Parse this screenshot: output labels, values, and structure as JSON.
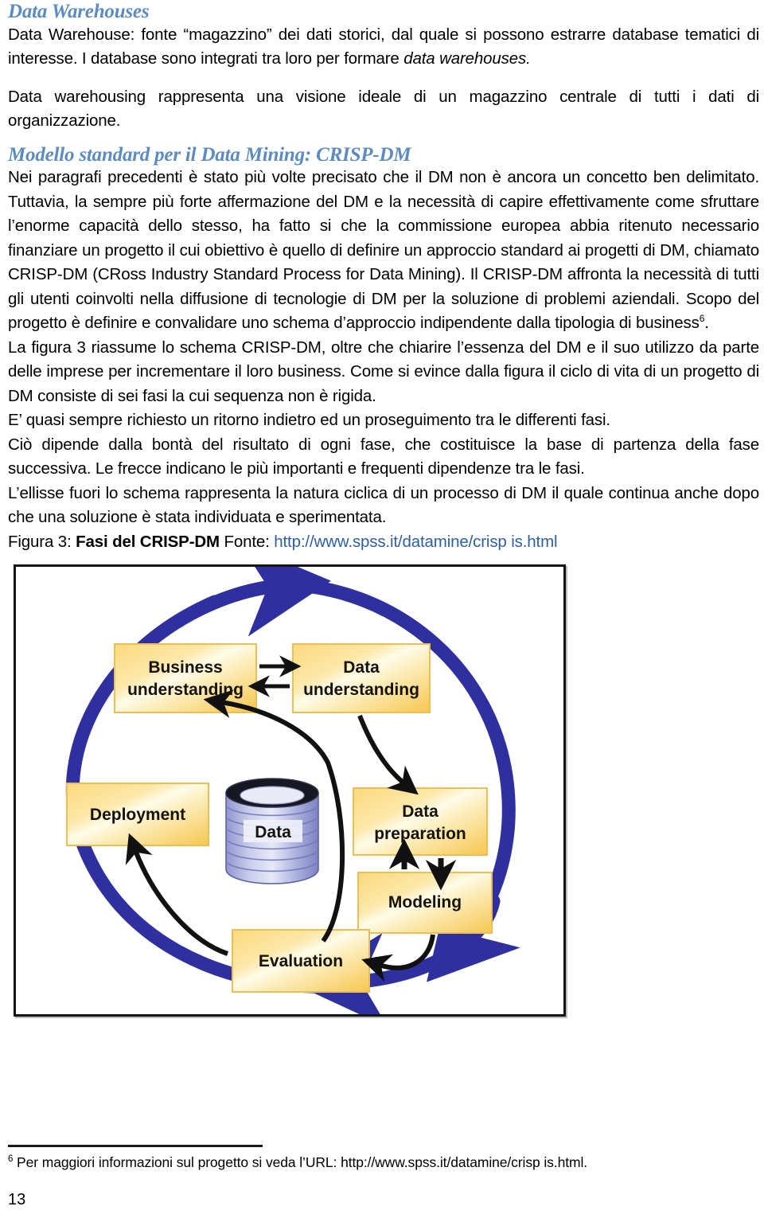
{
  "document": {
    "page_number": "13",
    "heading_color": "#5B8BC0",
    "link_color": "#2E5FA3"
  },
  "section_warehouses": {
    "heading": "Data Warehouses",
    "para1_a": "Data Warehouse: fonte “magazzino” dei dati storici, dal quale si possono estrarre database tematici di interesse. I database sono integrati tra loro per formare ",
    "para1_italic": "data warehouses.",
    "para2": "Data warehousing rappresenta una visione ideale di un magazzino centrale di tutti i dati di organizzazione."
  },
  "section_crisp": {
    "heading": "Modello standard per il Data Mining: CRISP-DM",
    "para1_a": "Nei paragrafi precedenti è stato più volte precisato che il DM non è ancora un concetto ben delimitato. Tuttavia, la sempre più forte affermazione del DM e la necessità di capire effettivamente come sfruttare l’enorme capacità dello stesso, ha fatto si che la commissione europea abbia ritenuto necessario finanziare un progetto il cui obiettivo è quello di definire un approccio standard ai progetti di DM, chiamato CRISP-DM (CRoss Industry Standard Process for Data Mining). Il CRISP-DM affronta la necessità di tutti gli utenti coinvolti nella diffusione di tecnologie di DM per la soluzione di problemi aziendali. Scopo del progetto è definire e convalidare uno schema d’approccio indipendente dalla tipologia di business",
    "para1_footnote_marker": "6",
    "para1_b": ".",
    "para2": "La figura 3 riassume lo schema CRISP-DM, oltre che chiarire l’essenza del DM e il suo utilizzo da parte delle imprese per incrementare il loro business. Come si evince dalla figura il ciclo di vita di un progetto di DM consiste di sei fasi la cui sequenza non è rigida.",
    "para3": "E’ quasi sempre richiesto un ritorno indietro ed un proseguimento tra le differenti fasi.",
    "para4": "Ciò dipende dalla bontà del risultato di ogni fase, che costituisce la base di partenza della fase successiva. Le frecce indicano le più importanti e frequenti dipendenze tra le fasi.",
    "para5": "L’ellisse fuori lo schema rappresenta la natura ciclica di un processo di DM il quale continua anche dopo che una soluzione è stata individuata e sperimentata."
  },
  "figure_caption": {
    "prefix": "Figura 3: ",
    "bold_title": "Fasi del CRISP-DM",
    "source_label": " Fonte: ",
    "url": "http://www.spss.it/datamine/crisp  is.html"
  },
  "figure": {
    "alt": "Schema CRISP-DM",
    "colors": {
      "cycle_arrow": "#2E30A0",
      "box_fill_dark": "#F5C council",
      "box_fill": "#FBD77A",
      "box_highlight": "#FDF3C4",
      "box_border": "#E8B84B",
      "cylinder": "#9FA8DE",
      "arrow": "#111111"
    },
    "nodes": [
      {
        "id": "business-understanding",
        "line1": "Business",
        "line2": "understanding"
      },
      {
        "id": "data-understanding",
        "line1": "Data",
        "line2": "understanding"
      },
      {
        "id": "data-preparation",
        "line1": "Data",
        "line2": "preparation"
      },
      {
        "id": "modeling",
        "line1": "Modeling",
        "line2": ""
      },
      {
        "id": "evaluation",
        "line1": "Evaluation",
        "line2": ""
      },
      {
        "id": "deployment",
        "line1": "Deployment",
        "line2": ""
      },
      {
        "id": "data-store",
        "line1": "Data",
        "line2": ""
      }
    ]
  },
  "footnote": {
    "marker": "6",
    "text": " Per maggiori informazioni sul progetto si veda l’URL: http://www.spss.it/datamine/crisp is.html."
  }
}
